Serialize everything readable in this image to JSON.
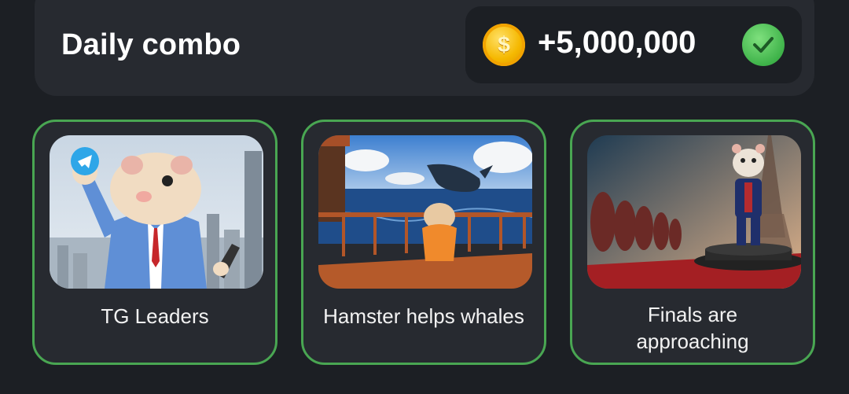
{
  "combo": {
    "title": "Daily combo",
    "reward": "+5,000,000",
    "coin_symbol": "$",
    "status_icon": "check-icon"
  },
  "cards": [
    {
      "label": "TG Leaders",
      "image": "hamster-businessman-telegram"
    },
    {
      "label": "Hamster helps whales",
      "image": "hamster-ship-whale"
    },
    {
      "label_line1": "Finals are",
      "label_line2": "approaching",
      "image": "hamster-eiffel-tower"
    }
  ],
  "colors": {
    "background": "#1c1f24",
    "panel": "#272a30",
    "card_border": "#49a652",
    "coin": "#f5b800",
    "check": "#3fb34a"
  }
}
